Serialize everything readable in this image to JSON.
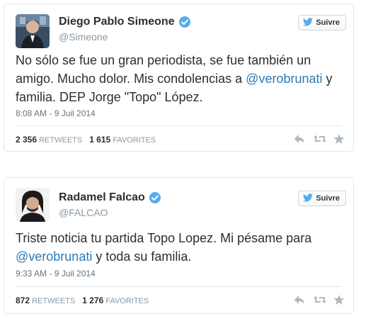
{
  "tweets": [
    {
      "name": "Diego Pablo Simeone",
      "handle": "@Simeone",
      "follow_label": "Suivre",
      "text_part1": "No sólo se fue un gran periodista, se fue también un amigo. Mucho dolor. Mis condolencias a ",
      "mention": "@verobrunati",
      "text_part2": " y familia. DEP Jorge \"Topo\" López.",
      "timestamp": "8:08 AM - 9 Juil 2014",
      "retweets": "2 356",
      "retweets_label": "RETWEETS",
      "favorites": "1 615",
      "favorites_label": "FAVORITES"
    },
    {
      "name": "Radamel Falcao",
      "handle": "@FALCAO",
      "follow_label": "Suivre",
      "text_part1": "Triste noticia tu partida Topo Lopez. Mi pésame para ",
      "mention": "@verobrunati",
      "text_part2": " y toda su familia.",
      "timestamp": "9:33 AM - 9 Juil 2014",
      "retweets": "872",
      "retweets_label": "RETWEETS",
      "favorites": "1 276",
      "favorites_label": "FAVORITES"
    }
  ],
  "icons": {
    "verified": "verified-badge-icon",
    "bird": "twitter-bird-icon",
    "reply": "reply-icon",
    "retweet": "retweet-icon",
    "favorite": "star-icon"
  },
  "colors": {
    "brand": "#55acee",
    "mention": "#2b7bb9",
    "name": "#292f33",
    "meta": "#8899a6"
  }
}
